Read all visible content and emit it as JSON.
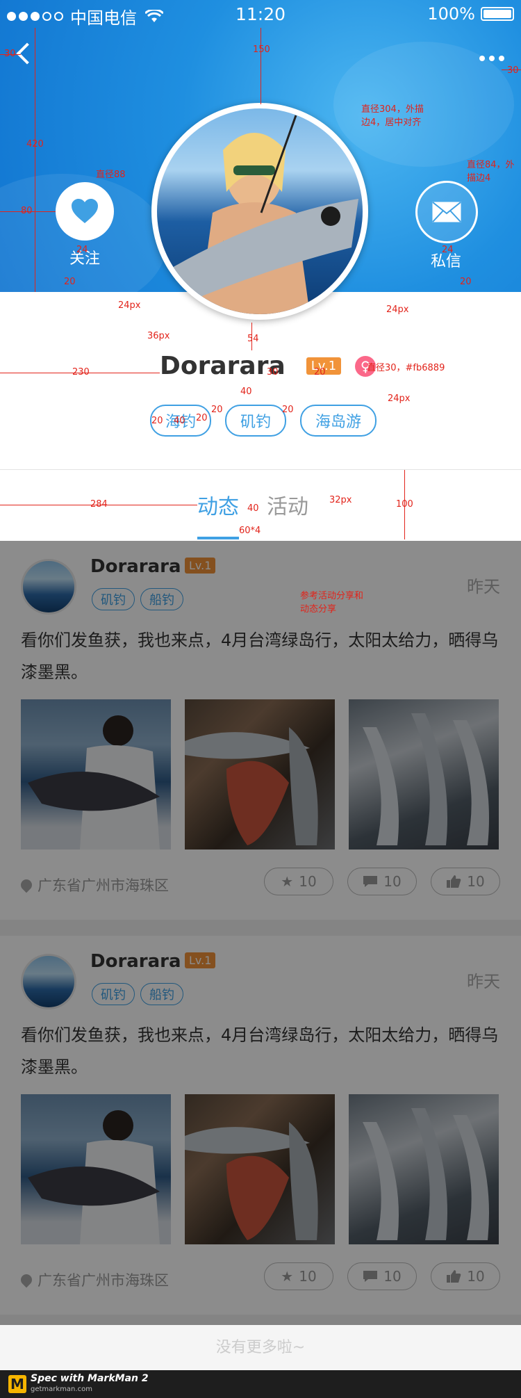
{
  "status_bar": {
    "carrier": "中国电信",
    "time": "11:20",
    "battery": "100%"
  },
  "profile": {
    "follow_label": "关注",
    "message_label": "私信",
    "username": "Dorarara",
    "level": "Lv.1",
    "gender_symbol": "♀",
    "tags": [
      "海钓",
      "矶钓",
      "海岛游"
    ]
  },
  "tabs": {
    "active": "动态",
    "other": "活动"
  },
  "feed": {
    "posts": [
      {
        "name": "Dorarara",
        "level": "Lv.1",
        "tags": [
          "矶钓",
          "船钓"
        ],
        "time": "昨天",
        "text": "看你们发鱼获，我也来点，4月台湾绿岛行，太阳太给力，晒得乌漆墨黑。",
        "location": "广东省广州市海珠区",
        "favorites": "10",
        "comments": "10",
        "likes": "10"
      },
      {
        "name": "Dorarara",
        "level": "Lv.1",
        "tags": [
          "矶钓",
          "船钓"
        ],
        "time": "昨天",
        "text": "看你们发鱼获，我也来点，4月台湾绿岛行，太阳太给力，晒得乌漆墨黑。",
        "location": "广东省广州市海珠区",
        "favorites": "10",
        "comments": "10",
        "likes": "10"
      }
    ],
    "no_more": "没有更多啦~"
  },
  "annotations": {
    "a_30_left": "30",
    "a_150": "150",
    "a_30_right": "30",
    "a_420": "420",
    "a_80": "80",
    "a_avatar_note": "直径304，外描边4，居中对齐",
    "a_follow_note": "直径88",
    "a_msg_note": "直径84，外描边4",
    "a_24_a": "24",
    "a_24_b": "24",
    "a_20_a": "20",
    "a_20_b": "20",
    "a_24px_a": "24px",
    "a_24px_b": "24px",
    "a_36px": "36px",
    "a_54": "54",
    "a_230": "230",
    "a_30_c": "30",
    "a_20_c": "20",
    "a_gender_note": "直径30，#fb6889",
    "a_40": "40",
    "a_20_d": "20",
    "a_40_b": "40",
    "a_20_e": "20",
    "a_20_f": "20",
    "a_20_g": "20",
    "a_24px_c": "24px",
    "a_284": "284",
    "a_40_c": "40",
    "a_32px": "32px",
    "a_100": "100",
    "a_60x4": "60*4",
    "a_share_note": "参考活动分享和动态分享"
  },
  "watermark": {
    "line1": "Spec with MarkMan 2",
    "line2": "getmarkman.com"
  },
  "colors": {
    "accent": "#3fa0e3",
    "level_badge": "#f19339",
    "gender": "#fb6889",
    "annotation": "#e2231a"
  }
}
